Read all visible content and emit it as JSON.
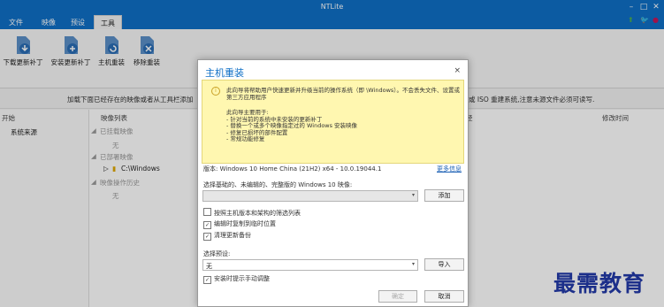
{
  "app": {
    "title": "NTLite"
  },
  "window_controls": {
    "minimize": "–",
    "maximize": "□",
    "close": "✕"
  },
  "menu": [
    {
      "label": "文件"
    },
    {
      "label": "映像"
    },
    {
      "label": "预设"
    },
    {
      "label": "工具"
    }
  ],
  "ribbon": {
    "buttons": [
      {
        "label": "下载更新补丁",
        "icon": "download-updates-icon"
      },
      {
        "label": "安装更新补丁",
        "icon": "install-updates-icon"
      },
      {
        "label": "主机重装",
        "icon": "host-reinstall-icon"
      },
      {
        "label": "移除重装",
        "icon": "remove-reinstall-icon"
      }
    ]
  },
  "infobar": {
    "left": "加载下面已经存在的映像或者从工具栏添加",
    "right": "或 ISO 重建系统,注意未源文件必须可读写."
  },
  "left_pane": {
    "header": "开始",
    "item": "系统来源"
  },
  "tree": {
    "header_list": "映像列表",
    "header_right": "修改时间",
    "header_mid": "径",
    "groups": [
      {
        "label": "已挂载映像",
        "child": "无"
      },
      {
        "label": "已部署映像",
        "child": "C:\\Windows"
      },
      {
        "label": "映像操作历史",
        "child": "无"
      }
    ]
  },
  "dialog": {
    "title": "主机重装",
    "close": "×",
    "notice_main": "此向导将帮助用户快速更新并升级当前的操作系统（即 \\Windows）。不会丢失文件、设置或第三方应用程序",
    "notice_list_title": "此向导主要用于:",
    "notice_items": [
      "- 针对当前的系统中未安装的更新补丁",
      "- 替换一个或多个映像指定过的 Windows 安装映像",
      "- 修复已损坏的部件配置",
      "- 常规功能修复"
    ],
    "version_label": "版本: Windows 10 Home China (21H2) x64 - 10.0.19044.1",
    "more_info": "更多信息",
    "select_label": "选择基础的、未编辑的、完整版的 Windows 10 映像:",
    "select_value": "",
    "add_button": "添加",
    "checkboxes": [
      {
        "label": "按照主机版本和架构的筛选列表",
        "checked": false
      },
      {
        "label": "编辑时复制到临时位置",
        "checked": true
      },
      {
        "label": "清理更新备份",
        "checked": true
      }
    ],
    "preset_label": "选择预设:",
    "preset_value": "无",
    "import_button": "导入",
    "prompt_checkbox": {
      "label": "安装时提示手动调整",
      "checked": true
    },
    "ok_button": "确定",
    "cancel_button": "取消"
  },
  "watermark": "最需教育",
  "colors": {
    "accent": "#0f6fc6",
    "notice_bg": "#fff7b0",
    "watermark": "#1c2f8a"
  }
}
